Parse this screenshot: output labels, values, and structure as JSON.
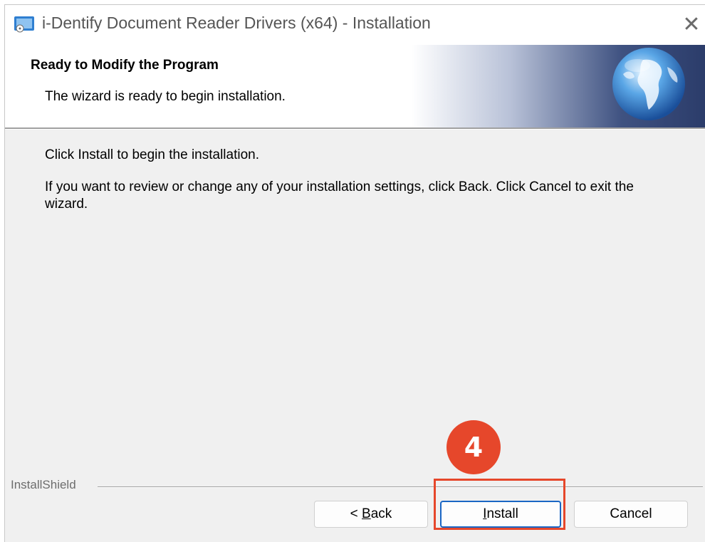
{
  "window": {
    "title": "i-Dentify Document Reader Drivers (x64) - Installation",
    "close_glyph": "✕"
  },
  "banner": {
    "title": "Ready to Modify the Program",
    "subtitle": "The wizard is ready to begin installation."
  },
  "body": {
    "line1": "Click Install to begin the installation.",
    "line2": "If you want to review or change any of your installation settings, click Back. Click Cancel to exit the wizard."
  },
  "footer": {
    "brand": "InstallShield"
  },
  "buttons": {
    "back_prefix": "< ",
    "back_mnemonic": "B",
    "back_rest": "ack",
    "install_mnemonic": "I",
    "install_rest": "nstall",
    "cancel": "Cancel"
  },
  "annotation": {
    "step_number": "4",
    "color": "#e6472b"
  },
  "icons": {
    "app": "installer-app-icon",
    "banner": "globe-icon",
    "close": "close-icon"
  }
}
